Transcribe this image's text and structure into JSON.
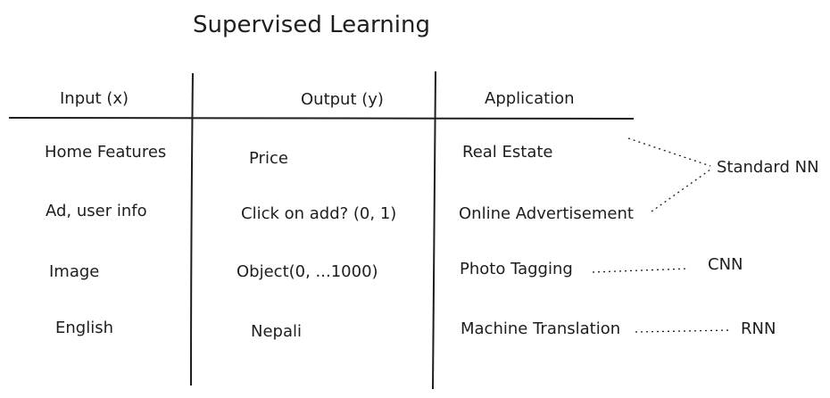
{
  "title": "Supervised Learning",
  "headers": {
    "input": "Input (x)",
    "output": "Output (y)",
    "application": "Application"
  },
  "rows": [
    {
      "input": "Home Features",
      "output": "Price",
      "application": "Real Estate"
    },
    {
      "input": "Ad, user info",
      "output": "Click on add? (0, 1)",
      "application": "Online Advertisement"
    },
    {
      "input": "Image",
      "output": "Object(0, ...1000)",
      "application": "Photo Tagging"
    },
    {
      "input": "English",
      "output": "Nepali",
      "application": "Machine Translation"
    }
  ],
  "networks": {
    "standard": "Standard NN",
    "cnn": "CNN",
    "rnn": "RNN"
  },
  "colors": {
    "ink": "#1e1e1e",
    "background": "#ffffff"
  }
}
